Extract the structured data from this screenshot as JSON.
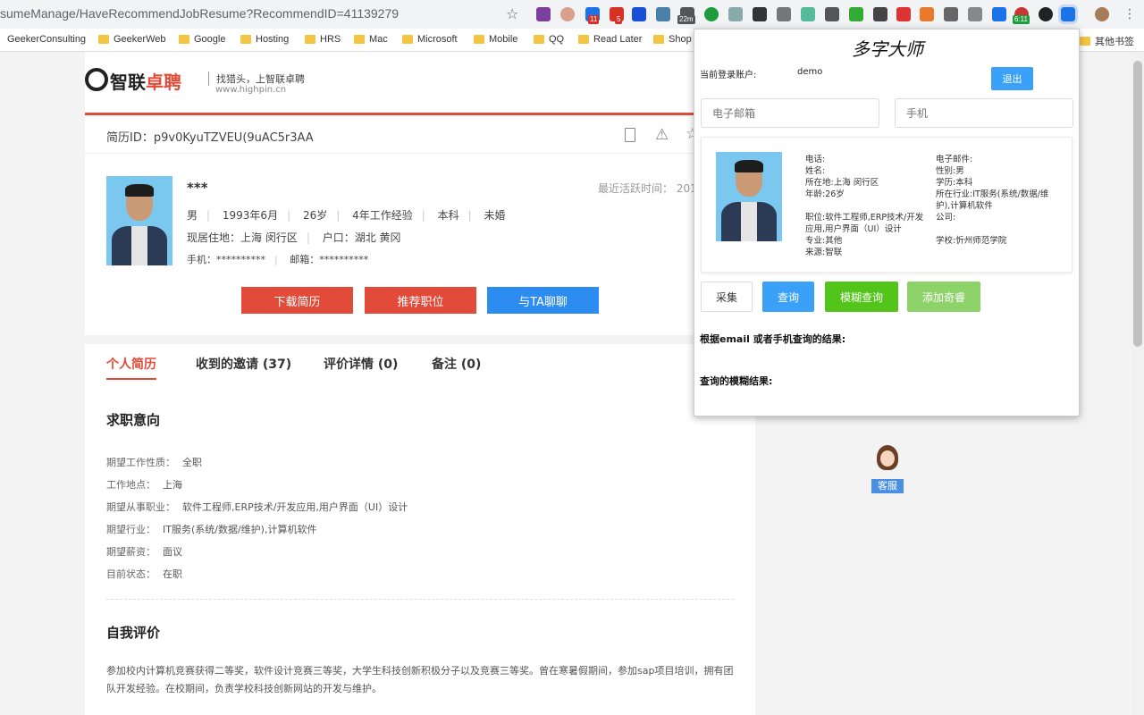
{
  "browser": {
    "url": "sumeManage/HaveRecommendJobResume?RecommendID=41139279",
    "bookmarks": [
      "GeekerConsulting",
      "GeekerWeb",
      "Google",
      "Hosting",
      "HRS",
      "Mac",
      "Microsoft",
      "Mobile",
      "QQ",
      "Read Later",
      "Shop",
      "其他书签"
    ],
    "badges": [
      "11",
      "5",
      "22m",
      "6:11"
    ]
  },
  "site": {
    "logo_text_a": "智联",
    "logo_text_b": "卓聘",
    "slogan": "找猎头，上智联卓聘",
    "domain": "www.highpin.cn"
  },
  "resume": {
    "id_label": "简历ID：",
    "id": "p9v0KyuTZVEU(9uAC5r3AA",
    "name": "***",
    "gender": "男",
    "birth": "1993年6月",
    "age": "26岁",
    "experience": "4年工作经验",
    "education": "本科",
    "marital": "未婚",
    "residence": "现居住地：上海 闵行区",
    "hukou": "户口：湖北 黄冈",
    "phone": "手机：**********",
    "email": "邮箱：**********",
    "last_active": "最近活跃时间： 201"
  },
  "actions": {
    "download": "下载简历",
    "recommend": "推荐职位",
    "chat": "与TA聊聊"
  },
  "tabs": [
    "个人简历",
    "收到的邀请 (37)",
    "评价详情 (0)",
    "备注 (0)"
  ],
  "intent": {
    "title": "求职意向",
    "rows": [
      {
        "label": "期望工作性质：",
        "value": "全职"
      },
      {
        "label": "工作地点：",
        "value": "上海"
      },
      {
        "label": "期望从事职业：",
        "value": "软件工程师,ERP技术/开发应用,用户界面（UI）设计"
      },
      {
        "label": "期望行业：",
        "value": "IT服务(系统/数据/维护),计算机软件"
      },
      {
        "label": "期望薪资：",
        "value": "面议"
      },
      {
        "label": "目前状态：",
        "value": "在职"
      }
    ]
  },
  "self_eval": {
    "title": "自我评价",
    "text": "参加校内计算机竞赛获得二等奖，软件设计竞赛三等奖，大学生科技创新积极分子以及竞赛三等奖。曾在寒暑假期间，参加sap项目培训，拥有团队开发经验。在校期间，负责学校科技创新网站的开发与维护。"
  },
  "support": {
    "label": "客服"
  },
  "popup": {
    "title": "多字大师",
    "account_label": "当前登录账户:",
    "account_user": "demo",
    "logout": "退出",
    "email_placeholder": "电子邮箱",
    "phone_placeholder": "手机",
    "left_fields": [
      "电话:",
      "姓名:",
      "所在地:上海 闵行区",
      "年龄:26岁",
      "",
      "职位:软件工程师,ERP技术/开发应用,用户界面（UI）设计",
      "专业:其他",
      "来源:智联"
    ],
    "right_fields": [
      "电子邮件:",
      "性别:男",
      "学历:本科",
      "所在行业:IT服务(系统/数据/维护),计算机软件",
      "公司:",
      "",
      "学校:忻州师范学院"
    ],
    "buttons": {
      "collect": "采集",
      "query": "查询",
      "fuzzy": "模糊查询",
      "add": "添加奇睿"
    },
    "result_email": "根据email 或者手机查询的结果:",
    "result_fuzzy": "查询的模糊结果:"
  }
}
